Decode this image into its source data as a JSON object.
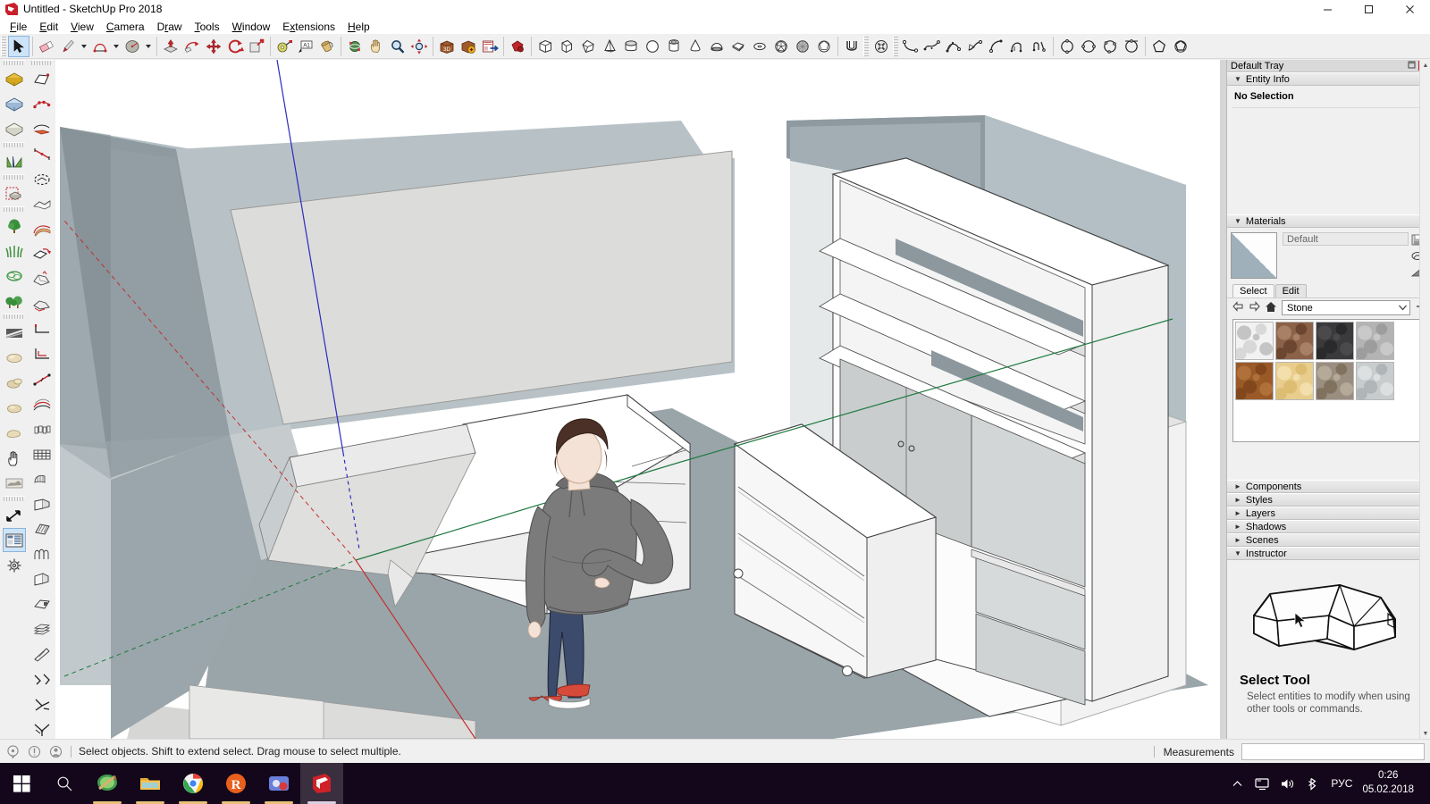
{
  "window": {
    "title": "Untitled - SketchUp Pro 2018",
    "app_icon": "sketchup-logo-icon",
    "minimize_label": "Minimize",
    "maximize_label": "Maximize",
    "close_label": "Close"
  },
  "menubar": {
    "items": [
      {
        "label": "File",
        "mnemonic": "F"
      },
      {
        "label": "Edit",
        "mnemonic": "E"
      },
      {
        "label": "View",
        "mnemonic": "V"
      },
      {
        "label": "Camera",
        "mnemonic": "C"
      },
      {
        "label": "Draw",
        "mnemonic": "D"
      },
      {
        "label": "Tools",
        "mnemonic": "T"
      },
      {
        "label": "Window",
        "mnemonic": "W"
      },
      {
        "label": "Extensions",
        "mnemonic": "x"
      },
      {
        "label": "Help",
        "mnemonic": "H"
      }
    ]
  },
  "toolbar_top": {
    "groups": [
      {
        "name": "principal",
        "buttons": [
          {
            "icon": "select-arrow-icon",
            "label": "Select",
            "selected": true
          },
          {
            "icon": "eraser-icon",
            "label": "Eraser"
          },
          {
            "icon": "pencil-line-icon",
            "label": "Line",
            "dropdown": true
          },
          {
            "icon": "arc-icon",
            "label": "Arc",
            "dropdown": true
          },
          {
            "icon": "circle-shape-icon",
            "label": "Shapes",
            "dropdown": true
          }
        ]
      },
      {
        "name": "modification",
        "buttons": [
          {
            "icon": "push-pull-icon",
            "label": "Push/Pull"
          },
          {
            "icon": "follow-me-icon",
            "label": "Follow Me"
          },
          {
            "icon": "move-icon",
            "label": "Move"
          },
          {
            "icon": "rotate-icon",
            "label": "Rotate"
          },
          {
            "icon": "scale-icon",
            "label": "Scale"
          }
        ]
      },
      {
        "name": "construction",
        "buttons": [
          {
            "icon": "tape-measure-icon",
            "label": "Tape Measure"
          },
          {
            "icon": "text-tool-icon",
            "label": "Text"
          },
          {
            "icon": "paint-bucket-icon",
            "label": "Paint Bucket"
          }
        ]
      },
      {
        "name": "camera",
        "buttons": [
          {
            "icon": "orbit-icon",
            "label": "Orbit"
          },
          {
            "icon": "pan-hand-icon",
            "label": "Pan"
          },
          {
            "icon": "zoom-magnifier-icon",
            "label": "Zoom"
          },
          {
            "icon": "zoom-extents-icon",
            "label": "Zoom Extents"
          }
        ]
      },
      {
        "name": "warehouse",
        "buttons": [
          {
            "icon": "3d-warehouse-icon",
            "label": "3D Warehouse"
          },
          {
            "icon": "share-model-icon",
            "label": "Share Model"
          },
          {
            "icon": "extension-warehouse-icon",
            "label": "Extension Warehouse"
          }
        ]
      },
      {
        "name": "ruby",
        "buttons": [
          {
            "icon": "ruby-console-icon",
            "label": "Ruby Console"
          }
        ]
      },
      {
        "name": "solid-shapes",
        "buttons": [
          {
            "icon": "box-icon",
            "label": "Box"
          },
          {
            "icon": "wedge-icon",
            "label": "Wedge"
          },
          {
            "icon": "prism-icon",
            "label": "Prism"
          },
          {
            "icon": "pyramid-icon",
            "label": "Pyramid"
          },
          {
            "icon": "cylinder-cut-icon",
            "label": "Cylinder"
          },
          {
            "icon": "sphere-icon",
            "label": "Sphere"
          },
          {
            "icon": "tube-icon",
            "label": "Tube"
          },
          {
            "icon": "cone-icon",
            "label": "Cone"
          },
          {
            "icon": "dome-icon",
            "label": "Dome"
          },
          {
            "icon": "plate-icon",
            "label": "Plate"
          },
          {
            "icon": "torus-icon",
            "label": "Torus"
          },
          {
            "icon": "polyhedron-icon",
            "label": "Polyhedron"
          },
          {
            "icon": "geodesic-icon",
            "label": "Geodesic"
          },
          {
            "icon": "faceted-sphere-icon",
            "label": "Faceted Sphere"
          }
        ]
      },
      {
        "name": "solid-tools",
        "buttons": [
          {
            "icon": "solid-union-icon",
            "label": "Union"
          }
        ]
      },
      {
        "name": "advanced-camera",
        "buttons": [
          {
            "icon": "gear-tool-icon",
            "label": "Advanced Camera Tools"
          }
        ]
      },
      {
        "name": "bezier",
        "buttons": [
          {
            "icon": "bezier-curve-icon",
            "label": "Bezier Curve"
          },
          {
            "icon": "classic-bezier-icon",
            "label": "Classic Bezier"
          },
          {
            "icon": "polyline-bezier-icon",
            "label": "Polyline Bezier"
          },
          {
            "icon": "spline-icon",
            "label": "Spline"
          },
          {
            "icon": "arc-tangent-icon",
            "label": "Arc Tangent"
          },
          {
            "icon": "curve-offset-icon",
            "label": "Offset Curve"
          },
          {
            "icon": "curve-edit-icon",
            "label": "Edit Curve"
          }
        ]
      },
      {
        "name": "circles",
        "buttons": [
          {
            "icon": "circle-center-icon",
            "label": "Circle by Center"
          },
          {
            "icon": "circle-diameter-icon",
            "label": "Circle by Diameter"
          },
          {
            "icon": "circle-3point-icon",
            "label": "Circle 3 Point"
          },
          {
            "icon": "circle-tangent-icon",
            "label": "Circle Tangent"
          }
        ]
      },
      {
        "name": "polygons",
        "buttons": [
          {
            "icon": "polygon-icon",
            "label": "Polygon"
          },
          {
            "icon": "polygon-inscribed-icon",
            "label": "Polygon Inscribed"
          }
        ]
      }
    ]
  },
  "toolbar_left_a": {
    "groups": [
      {
        "buttons": [
          {
            "icon": "solid-yellow-box-icon",
            "label": "Solid Inspector"
          },
          {
            "icon": "solid-blue-box-icon",
            "label": "Solid Subtract"
          },
          {
            "icon": "solid-grey-box-icon",
            "label": "Solid Trim"
          }
        ]
      },
      {
        "buttons": [
          {
            "icon": "gradient-triangles-icon",
            "label": "Shape Bender"
          }
        ]
      },
      {
        "buttons": [
          {
            "icon": "component-select-icon",
            "label": "Component Tools"
          }
        ]
      },
      {
        "buttons": [
          {
            "icon": "tree-icon",
            "label": "Add Tree"
          },
          {
            "icon": "grass-icon",
            "label": "Add Grass"
          },
          {
            "icon": "bush-outline-icon",
            "label": "Add Shrub"
          },
          {
            "icon": "trees-group-icon",
            "label": "Add Trees Group"
          }
        ]
      },
      {
        "buttons": [
          {
            "icon": "texture-strip-icon",
            "label": "Texture Tool"
          },
          {
            "icon": "stone-1-icon",
            "label": "Stone Tool 1"
          },
          {
            "icon": "stone-2-icon",
            "label": "Stone Tool 2"
          },
          {
            "icon": "stone-3-icon",
            "label": "Stone Tool 3"
          },
          {
            "icon": "stone-4-icon",
            "label": "Stone Tool 4"
          },
          {
            "icon": "hand-icon",
            "label": "Hand Tool"
          },
          {
            "icon": "terrain-icon",
            "label": "Terrain Tool"
          }
        ]
      },
      {
        "buttons": [
          {
            "icon": "resize-arrows-icon",
            "label": "Resize"
          },
          {
            "icon": "list-panel-icon",
            "label": "Panels",
            "selected": true
          },
          {
            "icon": "gear-icon",
            "label": "Settings"
          }
        ]
      }
    ]
  },
  "toolbar_left_b": {
    "buttons": [
      {
        "icon": "face-extrude-icon",
        "label": "Extrude Face"
      },
      {
        "icon": "bead-path-icon",
        "label": "Path Tool"
      },
      {
        "icon": "shape-sweep-icon",
        "label": "Sweep"
      },
      {
        "icon": "dimension-line-icon",
        "label": "Dimension"
      },
      {
        "icon": "dashed-loop-icon",
        "label": "Loop Select"
      },
      {
        "icon": "surface-fold-icon",
        "label": "Fold Surface"
      },
      {
        "icon": "curve-band-icon",
        "label": "Curved Band"
      },
      {
        "icon": "face-flip-icon",
        "label": "Flip Face"
      },
      {
        "icon": "joint-push-pull-icon",
        "label": "Joint Push Pull"
      },
      {
        "icon": "vector-push-pull-icon",
        "label": "Vector Push Pull"
      },
      {
        "icon": "corner-line-icon",
        "label": "Corner Line"
      },
      {
        "icon": "offset-corner-icon",
        "label": "Offset Corner"
      },
      {
        "icon": "line-measure-icon",
        "label": "Line Measure"
      },
      {
        "icon": "curve-loft-icon",
        "label": "Curve Loft"
      },
      {
        "icon": "lattice-icon",
        "label": "Lattice"
      },
      {
        "icon": "frame-grid-icon",
        "label": "Frame Grid"
      },
      {
        "icon": "plane-slice-icon",
        "label": "Plane Slice"
      },
      {
        "icon": "window-array-icon",
        "label": "Window Array"
      },
      {
        "icon": "column-array-icon",
        "label": "Column Array"
      },
      {
        "icon": "arch-array-icon",
        "label": "Arch Array"
      },
      {
        "icon": "taper-box-icon",
        "label": "Taper Box"
      },
      {
        "icon": "notch-box-icon",
        "label": "Notch Box"
      },
      {
        "icon": "stack-layers-icon",
        "label": "Stack Layers"
      },
      {
        "icon": "blade-split-icon",
        "label": "Split"
      },
      {
        "icon": "zigzag-path-icon",
        "label": "Zig Zag"
      },
      {
        "icon": "branch-path-icon",
        "label": "Branch"
      },
      {
        "icon": "cross-path-icon",
        "label": "Cross Path"
      },
      {
        "icon": "cone-tool-icon",
        "label": "Cone Tool"
      }
    ]
  },
  "tray": {
    "header": {
      "title": "Default Tray",
      "pin_label": "Auto-hide",
      "close_label": "x"
    },
    "panels": [
      {
        "name": "entity-info",
        "label": "Entity Info",
        "expanded": true,
        "closer": "x"
      },
      {
        "name": "materials",
        "label": "Materials",
        "expanded": true,
        "closer": "x"
      },
      {
        "name": "components",
        "label": "Components",
        "expanded": false,
        "closer": "x"
      },
      {
        "name": "styles",
        "label": "Styles",
        "expanded": false,
        "closer": "x"
      },
      {
        "name": "layers",
        "label": "Layers",
        "expanded": false,
        "closer": "x"
      },
      {
        "name": "shadows",
        "label": "Shadows",
        "expanded": false,
        "closer": "x"
      },
      {
        "name": "scenes",
        "label": "Scenes",
        "expanded": false,
        "closer": "x"
      },
      {
        "name": "instructor",
        "label": "Instructor",
        "expanded": true,
        "closer": "x"
      }
    ],
    "entity_info": {
      "status": "No Selection"
    },
    "materials": {
      "current_name": "Default",
      "current_swatch_icon": "default-material-swatch",
      "create_button_icon": "create-material-icon",
      "sample_button_icon": "sample-paint-icon",
      "display_button_icon": "display-swatch-icon",
      "tabs": [
        {
          "label": "Select",
          "active": true
        },
        {
          "label": "Edit",
          "active": false
        }
      ],
      "nav": {
        "back_icon": "arrow-left-icon",
        "forward_icon": "arrow-right-icon",
        "home_icon": "home-icon",
        "library": "Stone",
        "dropdown_icon": "chevron-down-icon",
        "details_icon": "details-arrow-icon"
      },
      "swatches": [
        {
          "name": "Stone Marble White",
          "c1": "#f2f2f2",
          "c2": "#d8d8d8",
          "c3": "#c4c4c4"
        },
        {
          "name": "Stone Granite Brown",
          "c1": "#8b6248",
          "c2": "#6c4631",
          "c3": "#a88066"
        },
        {
          "name": "Stone Charcoal",
          "c1": "#3a3a3c",
          "c2": "#2a2a2c",
          "c3": "#4a4a4c"
        },
        {
          "name": "Stone Grey Speckled",
          "c1": "#b3b3b3",
          "c2": "#9d9d9d",
          "c3": "#c9c9c9"
        },
        {
          "name": "Stone Terracotta",
          "c1": "#9a5a28",
          "c2": "#82471c",
          "c3": "#b0703a"
        },
        {
          "name": "Stone Sandstone",
          "c1": "#e8cd8d",
          "c2": "#dcbd72",
          "c3": "#f2dfab"
        },
        {
          "name": "Stone Pebble Mix",
          "c1": "#9a8e80",
          "c2": "#80725f",
          "c3": "#b5a998"
        },
        {
          "name": "Stone Light Grey",
          "c1": "#c8cccd",
          "c2": "#b0b5b7",
          "c3": "#dde0e1"
        }
      ]
    },
    "instructor": {
      "illustration_icon": "house-sketch-illustration",
      "cursor_icon": "mouse-pointer-icon",
      "title": "Select Tool",
      "description": "Select entities to modify when using other tools or commands."
    }
  },
  "statusbar": {
    "icons": [
      {
        "icon": "info-balloon-icon",
        "label": "Tips"
      },
      {
        "icon": "warning-circle-icon",
        "label": "Warnings"
      },
      {
        "icon": "user-account-icon",
        "label": "Account"
      }
    ],
    "message": "Select objects. Shift to extend select. Drag mouse to select multiple.",
    "measurements_label": "Measurements",
    "measurements_value": ""
  },
  "taskbar": {
    "start_icon": "windows-start-icon",
    "search_icon": "search-icon",
    "apps": [
      {
        "icon": "paint-app-icon",
        "label": "Paint",
        "active": false
      },
      {
        "icon": "file-explorer-icon",
        "label": "File Explorer",
        "active": false
      },
      {
        "icon": "chrome-icon",
        "label": "Google Chrome",
        "active": false
      },
      {
        "icon": "r-app-icon",
        "label": "R Studio",
        "active": false
      },
      {
        "icon": "blue-app-icon",
        "label": "Media App",
        "active": false
      },
      {
        "icon": "sketchup-app-icon",
        "label": "SketchUp Pro 2018",
        "active": true
      }
    ],
    "tray": {
      "chevron_icon": "chevron-up-icon",
      "network_icon": "network-monitor-icon",
      "volume_icon": "speaker-icon",
      "bluetooth_icon": "bluetooth-icon",
      "language": "РУС",
      "time": "0:26",
      "date": "05.02.2018"
    }
  },
  "canvas": {
    "scene_name": "interior-room-with-shelving-and-figure",
    "axes": {
      "green": "#1f7a3f",
      "blue": "#2b2bbf",
      "red": "#c03030"
    },
    "colors": {
      "sky_wall": "#b8c2c6",
      "wall_light": "#dcdcda",
      "wall_mid": "#9aa6ab",
      "floor": "#9aa5aa",
      "floor_light": "#d6d6d4",
      "furniture_white": "#fbfbfb",
      "furniture_shade": "#e4e4e4",
      "furniture_grey": "#c9cdce",
      "figure_hoodie": "#7b7b7b",
      "figure_jeans": "#3c4a6b",
      "figure_skin": "#f4e2d6",
      "figure_hair": "#4a3026",
      "figure_shoe": "#d64a3a"
    }
  }
}
